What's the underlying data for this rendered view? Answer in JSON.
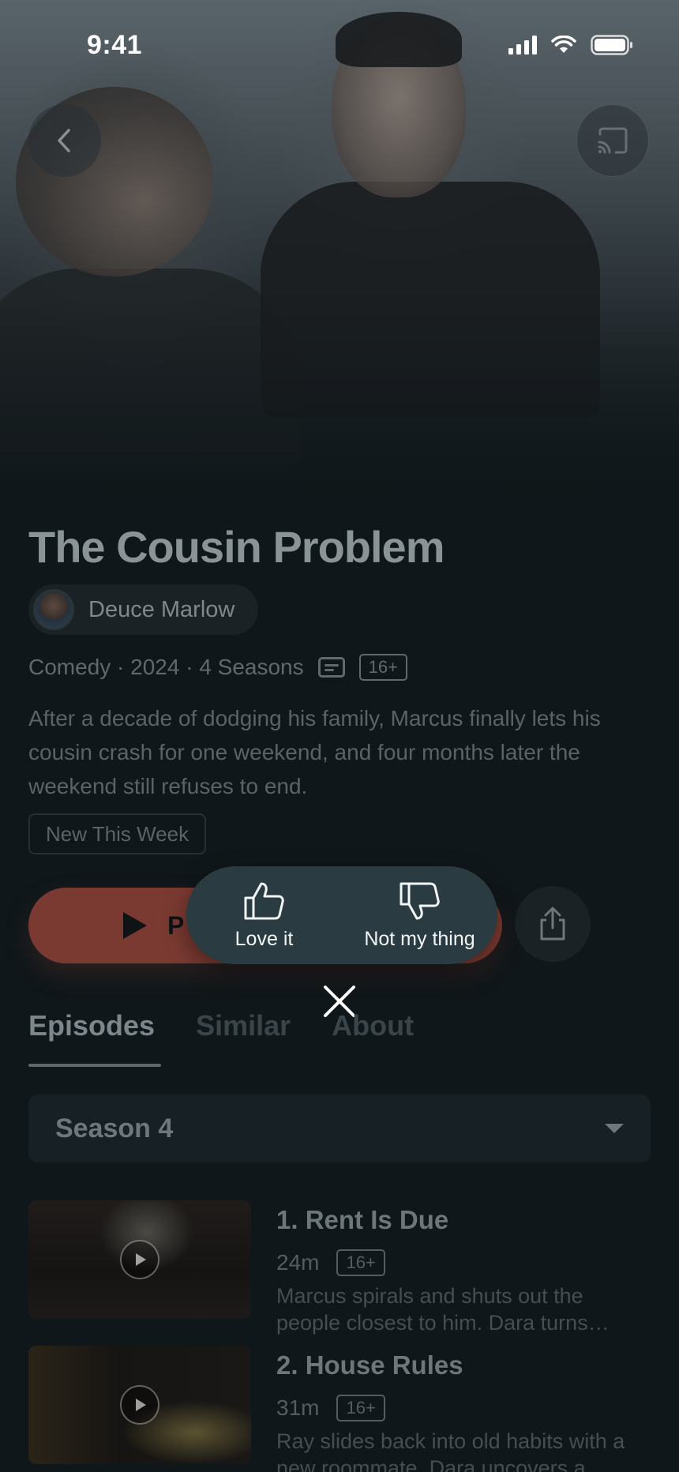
{
  "status_bar": {
    "time": "9:41"
  },
  "show": {
    "title": "The Cousin Problem",
    "creator": "Deuce Marlow",
    "genre_year_seasons": "Comedy · 2024 · 4 Seasons",
    "rating": "16+",
    "synopsis": "After a decade of dodging his family, Marcus finally lets his cousin crash for one weekend, and four months later the weekend still refuses to end.",
    "badge": "New This Week"
  },
  "actions": {
    "play_label": "P",
    "accent_color": "#7a3a31"
  },
  "rating_popup": {
    "love_label": "Love it",
    "dislike_label": "Not my thing"
  },
  "tabs": [
    {
      "label": "Episodes",
      "active": true
    },
    {
      "label": "Similar",
      "active": false
    },
    {
      "label": "About",
      "active": false
    }
  ],
  "season_select": {
    "selected": "Season 4"
  },
  "episodes": [
    {
      "title": "1. Rent Is Due",
      "duration": "24m",
      "rating": "16+",
      "description": "Marcus spirals and shuts out the people closest to him. Dara turns…"
    },
    {
      "title": "2. House Rules",
      "duration": "31m",
      "rating": "16+",
      "description": "Ray slides back into old habits with a new roommate. Dara uncovers a…"
    }
  ]
}
